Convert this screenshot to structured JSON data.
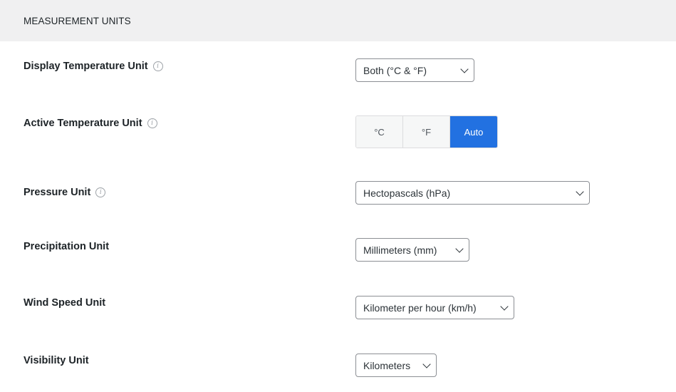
{
  "section": {
    "title": "MEASUREMENT UNITS"
  },
  "fields": {
    "display_temperature": {
      "label": "Display Temperature Unit",
      "value": "Both (°C & °F)"
    },
    "active_temperature": {
      "label": "Active Temperature Unit",
      "options": [
        "°C",
        "°F",
        "Auto"
      ],
      "selected": "Auto"
    },
    "pressure": {
      "label": "Pressure Unit",
      "value": "Hectopascals (hPa)"
    },
    "precipitation": {
      "label": "Precipitation Unit",
      "value": "Millimeters (mm)"
    },
    "wind_speed": {
      "label": "Wind Speed Unit",
      "value": "Kilometer per hour (km/h)"
    },
    "visibility": {
      "label": "Visibility Unit",
      "value": "Kilometers"
    }
  },
  "icons": {
    "info": "info-circle-icon",
    "dropdown": "chevron-down-icon"
  },
  "colors": {
    "accent": "#2271e1",
    "header_bg": "#f0f0f1"
  }
}
